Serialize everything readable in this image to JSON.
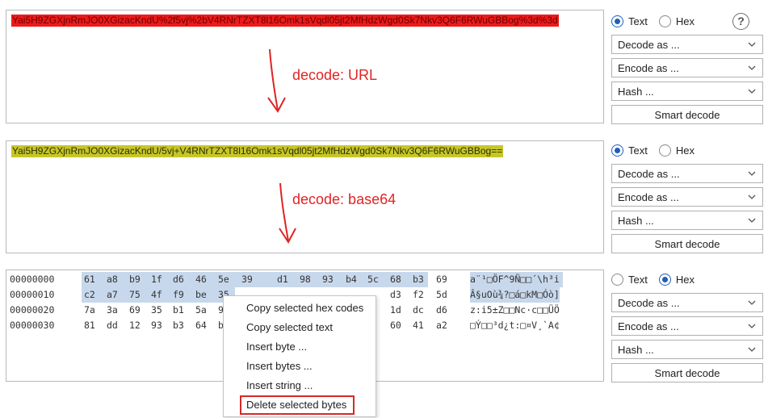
{
  "panels": [
    {
      "text": "Yai5H9ZGXjnRmJO0XGizacKndU%2f5vj%2bV4RNrTZXT8l16Omk1sVqdl05jt2MfHdzWgd0Sk7Nkv3Q6F6RWuGBBog%3d%3d",
      "highlight": "#ee1a1a"
    },
    {
      "text": "Yai5H9ZGXjnRmJO0XGizacKndU/5vj+V4RNrTZXT8l16Omk1sVqdl05jt2MfHdzWgd0Sk7Nkv3Q6F6RWuGBBog==",
      "highlight": "#c6c629"
    }
  ],
  "annotations": {
    "first": "decode: URL",
    "second": "decode: base64",
    "color": "#e02424"
  },
  "controls": [
    {
      "text_label": "Text",
      "hex_label": "Hex",
      "selected": "Text",
      "decode": "Decode as ...",
      "encode": "Encode as ...",
      "hash": "Hash ...",
      "smart": "Smart decode",
      "help": "?"
    },
    {
      "text_label": "Text",
      "hex_label": "Hex",
      "selected": "Text",
      "decode": "Decode as ...",
      "encode": "Encode as ...",
      "hash": "Hash ...",
      "smart": "Smart decode"
    },
    {
      "text_label": "Text",
      "hex_label": "Hex",
      "selected": "Hex",
      "decode": "Decode as ...",
      "encode": "Encode as ...",
      "hash": "Hash ...",
      "smart": "Smart decode"
    }
  ],
  "hex_rows": [
    {
      "offset": "00000000",
      "bytes": [
        "61",
        "a8",
        "b9",
        "1f",
        "d6",
        "46",
        "5e",
        "39",
        "d1",
        "98",
        "93",
        "b4",
        "5c",
        "68",
        "b3",
        "69"
      ],
      "ascii": "a¨¹□ÖF^9Ñ□□´\\h³i"
    },
    {
      "offset": "00000010",
      "bytes": [
        "c2",
        "a7",
        "75",
        "4f",
        "f9",
        "be",
        "35",
        "",
        "",
        "",
        "",
        "",
        "",
        "d3",
        "f2",
        "5d"
      ],
      "ascii": "Â§uOù¾?□á□kM□Óò]"
    },
    {
      "offset": "00000020",
      "bytes": [
        "7a",
        "3a",
        "69",
        "35",
        "b1",
        "5a",
        "9",
        "",
        "",
        "",
        "",
        "",
        "",
        "1d",
        "dc",
        "d6"
      ],
      "ascii": "z:i5±Z□□Nc·c□□ÜÖ"
    },
    {
      "offset": "00000030",
      "bytes": [
        "81",
        "dd",
        "12",
        "93",
        "b3",
        "64",
        "b",
        "",
        "",
        "",
        "",
        "",
        "",
        "60",
        "41",
        "a2"
      ],
      "ascii": "□Ý□□³d¿t:□¤V¸`A¢"
    }
  ],
  "context_menu": [
    "Copy selected hex codes",
    "Copy selected text",
    "Insert byte ...",
    "Insert bytes ...",
    "Insert string ...",
    "Delete selected bytes"
  ],
  "selection_color": "#c8d8ec",
  "accent": "#1f5fb8"
}
